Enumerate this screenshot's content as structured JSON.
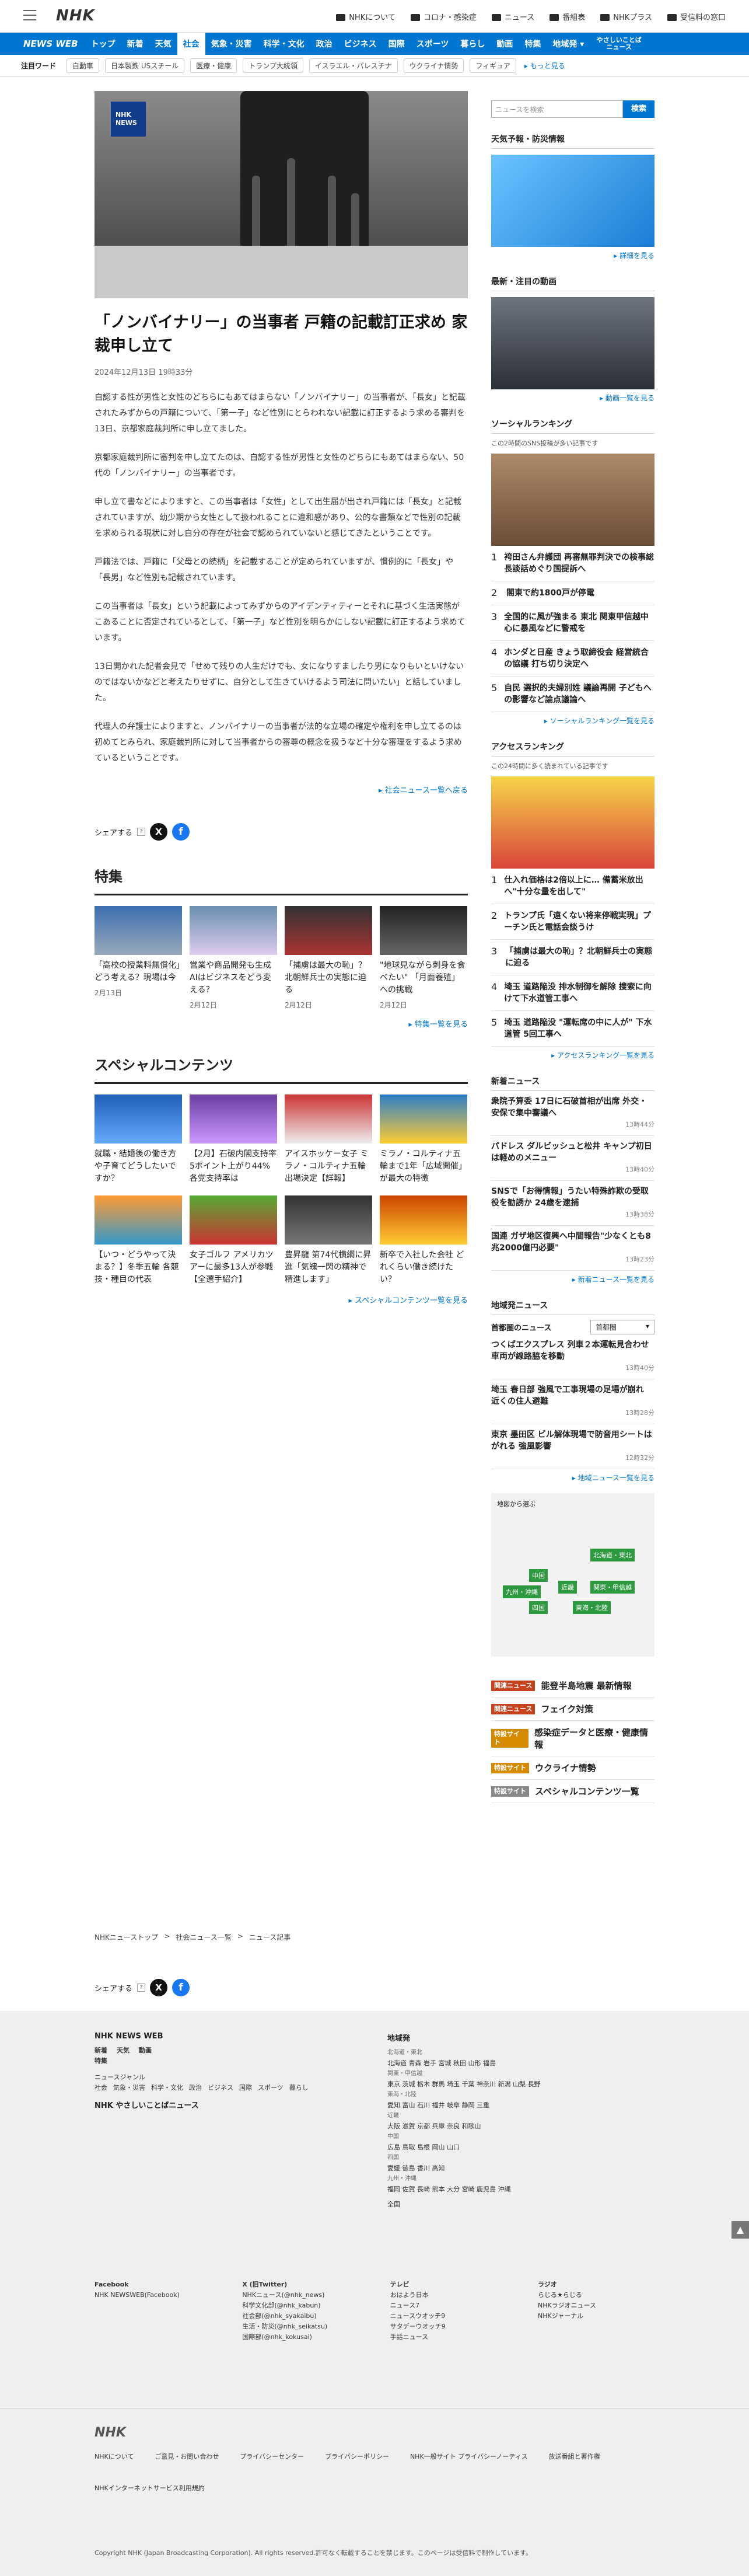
{
  "header": {
    "logo": "NHK",
    "links": [
      "NHKについて",
      "コロナ・感染症",
      "ニュース",
      "番組表",
      "NHKプラス",
      "受信料の窓口"
    ]
  },
  "nav": {
    "brand": "NEWS WEB",
    "categories": [
      "トップ",
      "新着",
      "天気",
      "社会",
      "気象・災害",
      "科学・文化",
      "政治",
      "ビジネス",
      "国際",
      "スポーツ",
      "暮らし",
      "動画",
      "特集",
      "地域発 ▾"
    ],
    "active": "社会",
    "easy": "やさしいことば ニュース"
  },
  "hot": {
    "label": "注目ワード",
    "chips": [
      "自動車",
      "日本製鉄 USスチール",
      "医療・健康",
      "トランプ大統領",
      "イスラエル・パレスチナ",
      "ウクライナ情勢",
      "フィギュア"
    ],
    "more": "もっと見る"
  },
  "article": {
    "title": "「ノンバイナリー」の当事者 戸籍の記載訂正求め 家裁申し立て",
    "date": "2024年12月13日 19時33分",
    "paragraphs": [
      "自認する性が男性と女性のどちらにもあてはまらない「ノンバイナリー」の当事者が、「長女」と記載されたみずからの戸籍について、「第一子」など性別にとらわれない記載に訂正するよう求める審判を13日、京都家庭裁判所に申し立てました。",
      "京都家庭裁判所に審判を申し立てたのは、自認する性が男性と女性のどちらにもあてはまらない、50代の「ノンバイナリー」の当事者です。",
      "申し立て書などによりますと、この当事者は「女性」として出生届が出され戸籍には「長女」と記載されていますが、幼少期から女性として扱われることに違和感があり、公的な書類などで性別の記載を求められる現状に対し自分の存在が社会で認められていないと感じてきたということです。",
      "戸籍法では、戸籍に「父母との続柄」を記載することが定められていますが、慣例的に「長女」や「長男」など性別も記載されています。",
      "この当事者は「長女」という記載によってみずからのアイデンティティーとそれに基づく生活実態がこあることに否定されているとして、「第一子」など性別を明らかにしない記載に訂正するよう求めています。",
      "13日開かれた記者会見で「せめて残りの人生だけでも、女になりすましたり男になりもいといけないのではないかなどと考えたりせずに、自分として生きていけるよう司法に問いたい」と話していました。",
      "代理人の弁護士によりますと、ノンバイナリーの当事者が法的な立場の確定や権利を申し立てるのは初めてとみられ、家庭裁判所に対して当事者からの審尊の概念を扱うなど十分な審理をするよう求めているということです。"
    ],
    "back_link": "社会ニュース一覧へ戻る",
    "share_label": "シェアする"
  },
  "feature": {
    "heading": "特集",
    "items": [
      {
        "title": "「高校の授業料無償化」どう考える？現場は今",
        "date": "2月13日"
      },
      {
        "title": "営業や商品開発も生成AIはビジネスをどう変える？",
        "date": "2月12日"
      },
      {
        "title": "「捕虜は最大の恥」？北朝鮮兵士の実態に迫る",
        "date": "2月12日"
      },
      {
        "title": "\"地球見ながら刺身を食べたい\" 「月面養殖」への挑戦",
        "date": "2月12日"
      }
    ],
    "more": "特集一覧を見る"
  },
  "special": {
    "heading": "スペシャルコンテンツ",
    "items": [
      {
        "title": "就職・結婚後の働き方や子育てどうしたいですか？"
      },
      {
        "title": "【2月】石破内閣支持率 5ポイント上がり44% 各党支持率は"
      },
      {
        "title": "アイスホッケー女子 ミラノ・コルティナ五輪出場決定【詳報】"
      },
      {
        "title": "ミラノ・コルティナ五輪まで1年「広域開催」が最大の特徴"
      },
      {
        "title": "【いつ・どうやって決まる？】冬季五輪 各競技・種目の代表"
      },
      {
        "title": "女子ゴルフ アメリカツアーに最多13人が参戦【全選手紹介】"
      },
      {
        "title": "豊昇龍 第74代横綱に昇進「気魄一閃の精神で精進します」"
      },
      {
        "title": "新卒で入社した会社 どれくらい働き続けたい？"
      }
    ],
    "more": "スペシャルコンテンツ一覧を見る"
  },
  "breadcrumb": [
    "NHKニューストップ",
    "社会ニュース一覧",
    "ニュース記事"
  ],
  "side": {
    "search_placeholder": "ニュースを検索",
    "search_btn": "検索",
    "weather_h": "天気予報・防災情報",
    "weather_more": "詳細を見る",
    "video_h": "最新・注目の動画",
    "video_more": "動画一覧を見る",
    "social_h": "ソーシャルランキング",
    "social_note": "この2時間のSNS投稿が多い記事です",
    "social": [
      "袴田さん弁護団 再審無罪判決での検事総長談話めぐり国提訴へ",
      "閣東で約1800戸が停電",
      "全国的に風が強まる 東北 関東甲信越中心に暴風などに警戒を",
      "ホンダと日産 きょう取締役会 経営統合の協議 打ち切り決定へ",
      "自民 選択的夫婦別姓 議論再開 子どもへの影響など論点議論へ"
    ],
    "social_more": "ソーシャルランキング一覧を見る",
    "access_h": "アクセスランキング",
    "access_note": "この24時間に多く読まれている記事です",
    "access": [
      "仕入れ価格は2倍以上に… 備蓄米放出へ\"十分な量を出して\"",
      "トランプ氏「遠くない将来停戦実現」プーチン氏と電話会談うけ",
      "「捕虜は最大の恥」？北朝鮮兵士の実態に迫る",
      "埼玉 道路陥没 排水制御を解除 搜索に向けて下水道管工事へ",
      "埼玉 道路陥没 \"運転席の中に人が\" 下水道管 5回工事へ"
    ],
    "access_more": "アクセスランキング一覧を見る",
    "new_h": "新着ニュース",
    "news": [
      {
        "t": "衆院予算委 17日に石破首相が出席 外交・安保で集中審議へ",
        "time": "13時44分"
      },
      {
        "t": "パドレス ダルビッシュと松井 キャンプ初日は軽めのメニュー",
        "time": "13時40分"
      },
      {
        "t": "SNSで「お得情報」うたい特殊詐欺の受取役を勧誘か 24歳を逮捕",
        "time": "13時38分"
      },
      {
        "t": "国連 ガザ地区復興へ中間報告\"少なくとも8兆2000億円必要\"",
        "time": "13時23分"
      }
    ],
    "new_more": "新着ニュース一覧を見る",
    "local_h": "地域発ニュース",
    "local_label": "首都圏のニュース",
    "local_select": "首都圏",
    "local": [
      {
        "t": "つくばエクスプレス 列車２本運転見合わせ 車両が線路脇を移動",
        "time": "13時40分"
      },
      {
        "t": "埼玉 春日部 強風で工事現場の足場が崩れ 近くの住人避難",
        "time": "13時28分"
      },
      {
        "t": "東京 墨田区 ビル解体現場で防音用シートはがれる 強風影響",
        "time": "12時32分"
      }
    ],
    "local_more": "地域ニュース一覧を見る",
    "map_label": "地図から選ぶ",
    "regions": [
      "北海道・東北",
      "関東・甲信越",
      "東海・北陸",
      "近畿",
      "中国",
      "四国",
      "九州・沖縄"
    ],
    "tags": [
      {
        "tag": "関連ニュース",
        "text": "能登半島地震 最新情報",
        "color": "#c7431e"
      },
      {
        "tag": "関連ニュース",
        "text": "フェイク対策",
        "color": "#c7431e"
      },
      {
        "tag": "特設サイト",
        "text": "感染症データと医療・健康情報",
        "color": "#d68a00"
      },
      {
        "tag": "特設サイト",
        "text": "ウクライナ情勢",
        "color": "#d68a00"
      },
      {
        "tag": "特設サイト",
        "text": "スペシャルコンテンツ一覧",
        "color": "#888"
      }
    ]
  },
  "footer": {
    "brand": "NHK NEWS WEB",
    "row1": [
      "新着",
      "天気",
      "動画"
    ],
    "row2": [
      "特集"
    ],
    "genre_h": "ニュースジャンル",
    "genres": [
      "社会",
      "気象・災害",
      "科学・文化",
      "政治",
      "ビジネス",
      "国際",
      "スポーツ",
      "暮らし"
    ],
    "easy": "NHK やさしいことばニュース",
    "region_h": "地域発",
    "regions": [
      {
        "area": "北海道・東北",
        "prefs": "北海道 青森 岩手 宮城 秋田 山形 福島"
      },
      {
        "area": "関東・甲信越",
        "prefs": "東京 茨城 栃木 群馬 埼玉 千葉 神奈川 新潟 山梨 長野"
      },
      {
        "area": "東海・北陸",
        "prefs": "愛知 富山 石川 福井 岐阜 静岡 三重"
      },
      {
        "area": "近畿",
        "prefs": "大阪 滋賀 京都 兵庫 奈良 和歌山"
      },
      {
        "area": "中国",
        "prefs": "広島 鳥取 島根 岡山 山口"
      },
      {
        "area": "四国",
        "prefs": "愛媛 徳島 香川 高知"
      },
      {
        "area": "九州・沖縄",
        "prefs": "福岡 佐賀 長崎 熊本 大分 宮崎 鹿児島 沖縄"
      },
      {
        "area": "",
        "prefs": "全国"
      }
    ],
    "fb_h": "Facebook",
    "fb": [
      "NHK NEWSWEB(Facebook)"
    ],
    "x_h": "X (旧Twitter)",
    "x": [
      "NHKニュース(@nhk_news)",
      "科学文化部(@nhk_kabun)",
      "社会部(@nhk_syakaibu)",
      "生活・防災(@nhk_seikatsu)",
      "国際部(@nhk_kokusai)"
    ],
    "tv_h": "テレビ",
    "tv": [
      "おはよう日本",
      "ニュース7",
      "ニュースウオッチ9",
      "サタデーウオッチ9",
      "手話ニュース"
    ],
    "radio_h": "ラジオ",
    "radio": [
      "らじる★らじる",
      "NHKラジオニュース",
      "NHKジャーナル"
    ],
    "logo": "NHK",
    "bottom_links": [
      "NHKについて",
      "ご意見・お問い合わせ",
      "プライバシーセンター",
      "プライバシーポリシー",
      "NHK一般サイト プライバシーノーティス",
      "放送番組と著作権",
      "NHKインターネットサービス利用規約"
    ],
    "copyright": "Copyright NHK (Japan Broadcasting Corporation). All rights reserved.許可なく転載することを禁じます。このページは受信料で制作しています。"
  }
}
